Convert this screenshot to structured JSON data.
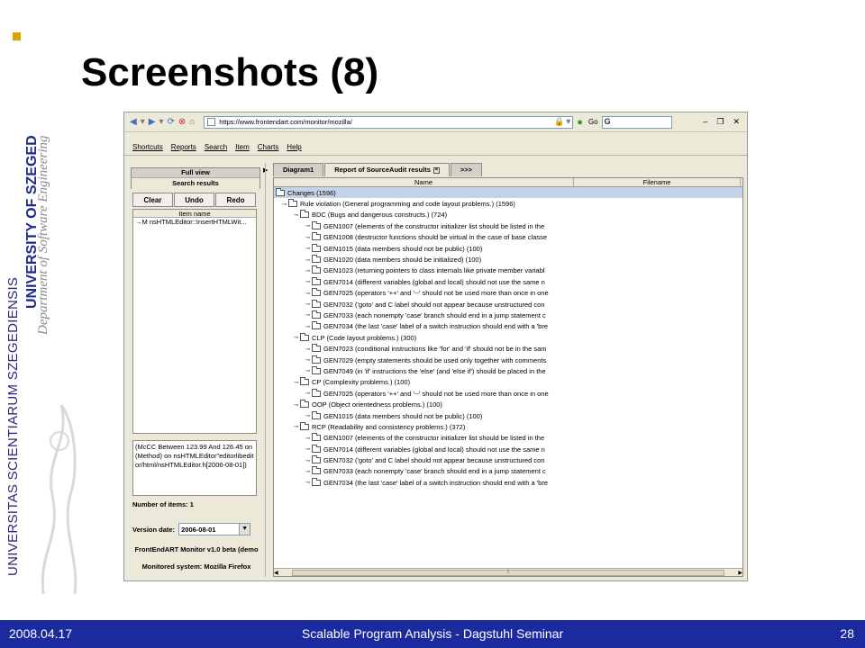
{
  "branding": {
    "vertical_university_latin": "UNIVERSITAS SCIENTIARUM SZEGEDIENSIS",
    "vertical_university": "UNIVERSITY OF SZEGED",
    "vertical_department": "Department of Software Engineering",
    "accent_color": "#d9a300",
    "footer_color": "#1c2aa0"
  },
  "slide": {
    "title": "Screenshots (8)"
  },
  "browser": {
    "address": "https://www.frontendart.com/monitor/mozilla/",
    "go_label": "Go",
    "search_value": "G"
  },
  "menu": [
    "Shortcuts",
    "Reports",
    "Search",
    "Item",
    "Charts",
    "Help"
  ],
  "left_panel": {
    "tab_full_view": "Full view",
    "tab_search_results": "Search results",
    "buttons": {
      "clear": "Clear",
      "undo": "Undo",
      "redo": "Redo"
    },
    "list_header": "Item name",
    "list_items": [
      "→M nsHTMLEditor::InsertHTMLWit..."
    ],
    "description": "(McCC Between 123.99 And 126.45 on (Method) on nsHTMLEditor\"editorlibeditor/html/nsHTMLEditor.h[2006-08-01])",
    "count_text": "Number of items: 1",
    "version_label": "Version date:",
    "version_value": "2006-08-01",
    "monitor_text": "FrontEndART Monitor v1.0 beta (demo",
    "system_text": "Monitored system: Mozilla Firefox"
  },
  "right_panel": {
    "tabs": [
      "Diagram1",
      "Report of SourceAudit results",
      ">>>"
    ],
    "columns": [
      "Name",
      "Filename"
    ],
    "rows": [
      {
        "level": 0,
        "text": "Changes (1596)",
        "selected": true
      },
      {
        "level": 1,
        "text": "Rule violation (General programming and code layout problems.)  (1596)"
      },
      {
        "level": 2,
        "text": "BDC (Bugs and dangerous constructs.)  (724)"
      },
      {
        "level": 3,
        "text": "GEN1007 (elements of the constructor initializer list should be listed in the"
      },
      {
        "level": 3,
        "text": "GEN1008 (destructor functions should be virtual in the case of base classe"
      },
      {
        "level": 3,
        "text": "GEN1015 (data members should not be public)  (100)"
      },
      {
        "level": 3,
        "text": "GEN1020 (data members should be initialized)  (100)"
      },
      {
        "level": 3,
        "text": "GEN1023 (returning pointers to class internals like private member variabl"
      },
      {
        "level": 3,
        "text": "GEN7014 (different variables (global and local) should not use the same n"
      },
      {
        "level": 3,
        "text": "GEN7025 (operators '++' and '--' should not be used more than once in one"
      },
      {
        "level": 3,
        "text": "GEN7032 ('goto' and C label should not appear because unstructured con"
      },
      {
        "level": 3,
        "text": "GEN7033 (each nonempty 'case' branch should end in a jump statement c"
      },
      {
        "level": 3,
        "text": "GEN7034 (the last 'case' label of a switch instruction should end with a 'bre"
      },
      {
        "level": 2,
        "text": "CLP (Code layout problems.)  (300)"
      },
      {
        "level": 3,
        "text": "GEN7023 (conditional instructions like 'for' and 'if' should not be in the sam"
      },
      {
        "level": 3,
        "text": "GEN7029 (empty statements should be used only together with comments"
      },
      {
        "level": 3,
        "text": "GEN7049 (in 'if' instructions the 'else' (and 'else if') should be placed in the"
      },
      {
        "level": 2,
        "text": "CP (Complexity problems.)  (100)"
      },
      {
        "level": 3,
        "text": "GEN7025 (operators '++' and '--' should not be used more than once in one"
      },
      {
        "level": 2,
        "text": "OOP (Object orientedness problems.)  (100)"
      },
      {
        "level": 3,
        "text": "GEN1015 (data members should not be public)  (100)"
      },
      {
        "level": 2,
        "text": "RCP (Readability and consistency problems.)  (372)"
      },
      {
        "level": 3,
        "text": "GEN1007 (elements of the constructor initializer list should be listed in the"
      },
      {
        "level": 3,
        "text": "GEN7014 (different variables (global and local) should not use the same n"
      },
      {
        "level": 3,
        "text": "GEN7032 ('goto' and C label should not appear because unstructured con"
      },
      {
        "level": 3,
        "text": "GEN7033 (each nonempty 'case' branch should end in a jump statement c"
      },
      {
        "level": 3,
        "text": "GEN7034 (the last 'case' label of a switch instruction should end with a 'bre"
      }
    ]
  },
  "footer": {
    "date": "2008.04.17",
    "title": "Scalable Program Analysis - Dagstuhl Seminar",
    "page": "28"
  }
}
